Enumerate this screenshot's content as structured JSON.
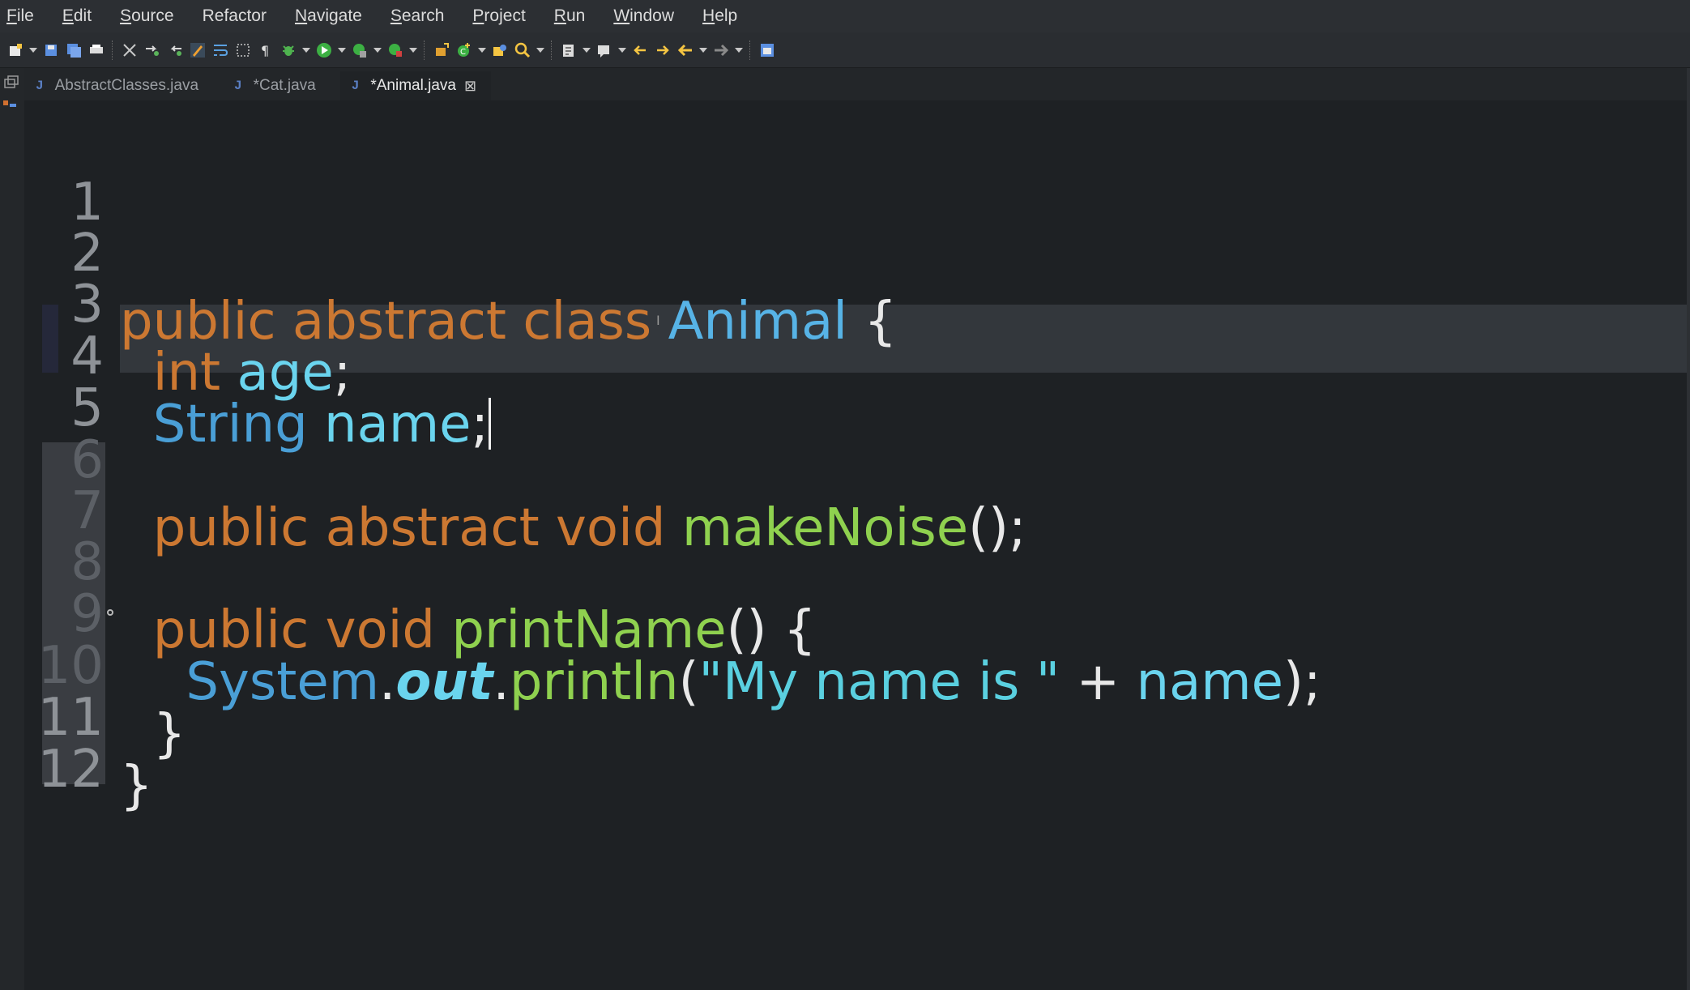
{
  "menu": {
    "items": [
      {
        "label": "File",
        "mnemonic": "F",
        "rest": "ile"
      },
      {
        "label": "Edit",
        "mnemonic": "E",
        "rest": "dit"
      },
      {
        "label": "Source",
        "mnemonic": "S",
        "rest": "ource"
      },
      {
        "label": "Refactor",
        "mnemonic": "",
        "rest": "Refactor"
      },
      {
        "label": "Navigate",
        "mnemonic": "N",
        "rest": "avigate"
      },
      {
        "label": "Search",
        "mnemonic": "S",
        "rest": "earch"
      },
      {
        "label": "Project",
        "mnemonic": "P",
        "rest": "roject"
      },
      {
        "label": "Run",
        "mnemonic": "R",
        "rest": "un"
      },
      {
        "label": "Window",
        "mnemonic": "W",
        "rest": "indow"
      },
      {
        "label": "Help",
        "mnemonic": "H",
        "rest": "elp"
      }
    ]
  },
  "tabs": [
    {
      "label": "AbstractClasses.java",
      "active": false,
      "icon": "java-file-icon"
    },
    {
      "label": "*Cat.java",
      "active": false,
      "icon": "java-file-icon"
    },
    {
      "label": "*Animal.java",
      "active": true,
      "icon": "java-file-icon",
      "close": "⊠"
    }
  ],
  "tab_icon_glyph": "J",
  "editor": {
    "line_numbers": [
      "1",
      "2",
      "3",
      "4",
      "5",
      "6",
      "7",
      "8",
      "9",
      "10",
      "11",
      "12"
    ],
    "line2": {
      "kw1": "public",
      "kw2": "abstract",
      "kw3": "class",
      "cls": "Animal",
      "brace": "{"
    },
    "line3": {
      "type": "int",
      "field": "age",
      "semi": ";"
    },
    "line4": {
      "type": "String",
      "field": "name",
      "semi": ";"
    },
    "line6": {
      "kw1": "public",
      "kw2": "abstract",
      "kw3": "void",
      "method": "makeNoise",
      "rest": "();"
    },
    "line8": {
      "kw1": "public",
      "kw2": "void",
      "method": "printName",
      "rest": "() {"
    },
    "line9": {
      "cls": "System",
      "dot1": ".",
      "stat": "out",
      "dot2": ".",
      "method": "println",
      "open": "(",
      "str": "\"My name is \"",
      "plus": " + ",
      "field": "name",
      "close": ");"
    },
    "line10": {
      "brace": "}"
    },
    "line11": {
      "brace": "}"
    }
  },
  "colors": {
    "keyword": "#cc7832",
    "type": "#4a9fd6",
    "field": "#6ad4ee",
    "method": "#8fd14f",
    "background": "#1e2124"
  }
}
